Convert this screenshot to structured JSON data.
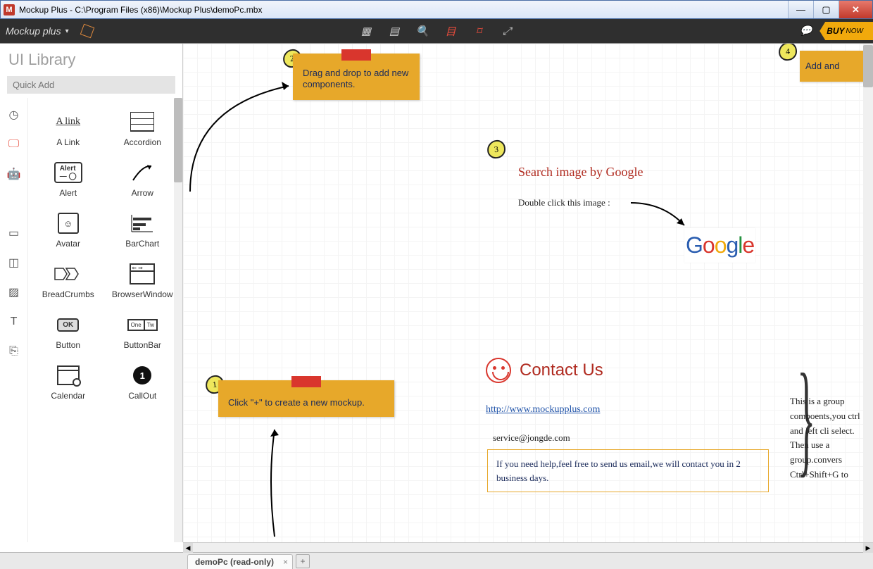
{
  "window": {
    "title": "Mockup Plus - C:\\Program Files (x86)\\Mockup Plus\\demoPc.mbx",
    "app_badge": "M"
  },
  "toolbar": {
    "brand": "Mockup plus",
    "buy": "BUY",
    "buy_now": "NOW"
  },
  "sidebar": {
    "title": "UI Library",
    "quick_add_placeholder": "Quick Add",
    "components": [
      {
        "label": "A Link"
      },
      {
        "label": "Accordion"
      },
      {
        "label": "Alert"
      },
      {
        "label": "Arrow"
      },
      {
        "label": "Avatar"
      },
      {
        "label": "BarChart"
      },
      {
        "label": "BreadCrumbs"
      },
      {
        "label": "BrowserWindow"
      },
      {
        "label": "Button"
      },
      {
        "label": "ButtonBar"
      },
      {
        "label": "Calendar"
      },
      {
        "label": "CallOut"
      }
    ]
  },
  "canvas": {
    "note1": {
      "num": "1",
      "text": "Click \"+\" to create a new mockup."
    },
    "note2": {
      "num": "2",
      "text": "Drag and drop to add new components."
    },
    "note3_num": "3",
    "note4_num": "4",
    "note4_text": "Add and",
    "search_title": "Search image by Google",
    "search_hint": "Double click this image :",
    "google": {
      "g1": "G",
      "o1": "o",
      "o2": "o",
      "g2": "g",
      "l": "l",
      "e": "e"
    },
    "contact_title": "Contact Us",
    "contact_url": "http://www.mockupplus.com",
    "contact_email": "service@jongde.com",
    "contact_help": "If you need help,feel free to send us email,we will contact you in 2 business days.",
    "group_note": "This is a group compoents,you ctrl and left cli select. Then use a group.convers Ctrl+Shift+G to"
  },
  "tabs": {
    "active": "demoPc (read-only)"
  }
}
